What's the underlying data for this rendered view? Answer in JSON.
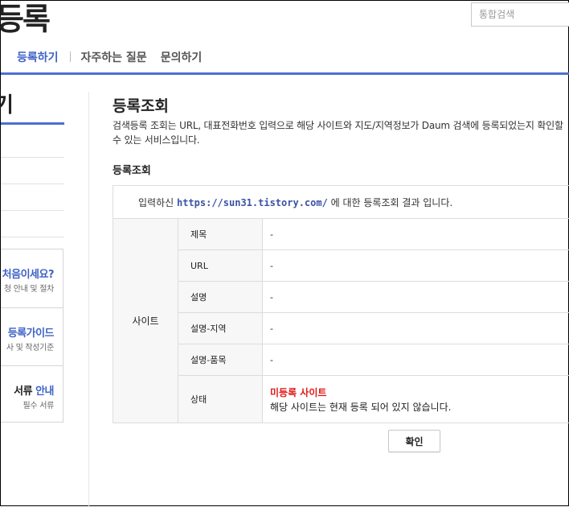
{
  "header": {
    "title": "등록",
    "search_placeholder": "통합검색"
  },
  "nav": {
    "items": [
      {
        "label": "등록하기",
        "active": true
      },
      {
        "label": "자주하는 질문",
        "active": false
      },
      {
        "label": "문의하기",
        "active": false
      }
    ]
  },
  "sidebar": {
    "title": "기",
    "guides": [
      {
        "title_blue": "처음이세요?",
        "title_dark": "",
        "sub": "청 안내 및 절차"
      },
      {
        "title_blue": "등록가이드",
        "title_dark": "",
        "sub": "사 및 작성기준"
      },
      {
        "title_blue": "안내",
        "title_dark": "서류 ",
        "sub": "필수 서류"
      }
    ]
  },
  "main": {
    "title": "등록조회",
    "description": "검색등록 조회는 URL, 대표전화번호 입력으로 해당 사이트와 지도/지역정보가 Daum 검색에 등록되었는지 확인할 수 있는 서비스입니다.",
    "subtitle": "등록조회",
    "result": {
      "msg_prefix": "입력하신 ",
      "url": "https://sun31.tistory.com/",
      "msg_suffix": " 에 대한 등록조회 결과 입니다.",
      "group_label": "사이트",
      "rows": [
        {
          "label": "제목",
          "value": "-"
        },
        {
          "label": "URL",
          "value": "-"
        },
        {
          "label": "설명",
          "value": "-"
        },
        {
          "label": "설명-지역",
          "value": "-"
        },
        {
          "label": "설명-품목",
          "value": "-"
        }
      ],
      "status": {
        "label": "상태",
        "value": "미등록 사이트",
        "detail": "해당 사이트는 현재 등록 되어 있지 않습니다.",
        "color": "#e0191b"
      }
    },
    "confirm_label": "확인"
  },
  "colors": {
    "accent": "#4d6fd1",
    "link": "#3f63c6"
  }
}
